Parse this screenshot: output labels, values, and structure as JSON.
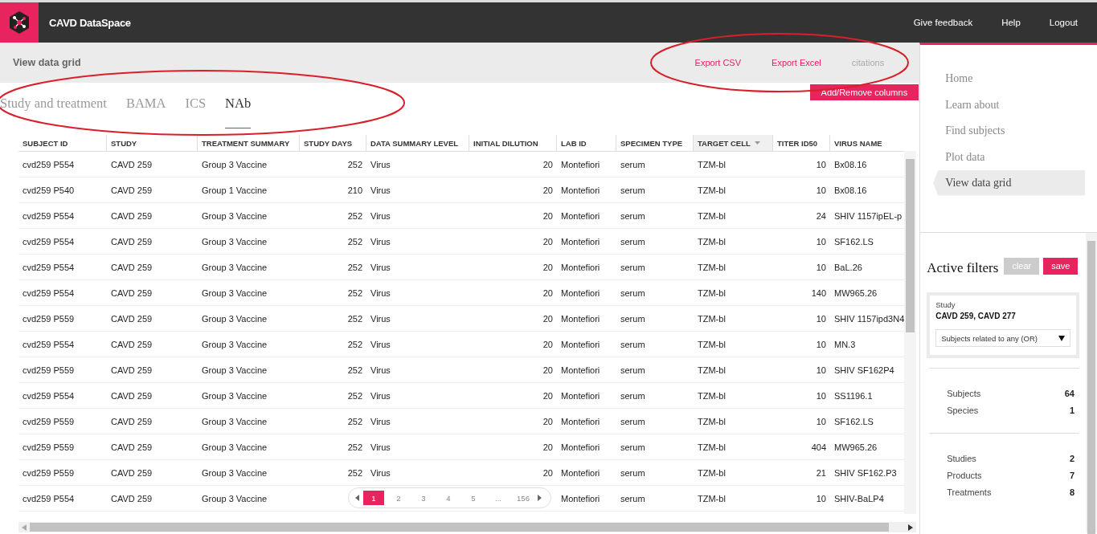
{
  "header": {
    "app_name": "CAVD DataSpace",
    "links": [
      "Give feedback",
      "Help",
      "Logout"
    ]
  },
  "title_bar": {
    "title": "View data grid",
    "actions": [
      {
        "label": "Export CSV",
        "kind": "link"
      },
      {
        "label": "Export Excel",
        "kind": "link"
      },
      {
        "label": "citations",
        "kind": "muted"
      }
    ]
  },
  "add_columns_button": "Add/Remove columns",
  "tabs": [
    {
      "label": "Study and treatment",
      "selected": false
    },
    {
      "label": "BAMA",
      "selected": false
    },
    {
      "label": "ICS",
      "selected": false
    },
    {
      "label": "NAb",
      "selected": true
    }
  ],
  "table": {
    "columns": [
      {
        "label": "SUBJECT ID",
        "sorted": false
      },
      {
        "label": "STUDY",
        "sorted": false
      },
      {
        "label": "TREATMENT SUMMARY",
        "sorted": false
      },
      {
        "label": "STUDY DAYS",
        "sorted": false
      },
      {
        "label": "DATA SUMMARY LEVEL",
        "sorted": false
      },
      {
        "label": "INITIAL DILUTION",
        "sorted": false
      },
      {
        "label": "LAB ID",
        "sorted": false
      },
      {
        "label": "SPECIMEN TYPE",
        "sorted": false
      },
      {
        "label": "TARGET CELL",
        "sorted": true
      },
      {
        "label": "TITER ID50",
        "sorted": false
      },
      {
        "label": "VIRUS NAME",
        "sorted": false
      }
    ],
    "rows": [
      {
        "subject_id": "cvd259 P554",
        "study": "CAVD 259",
        "treatment_summary": "Group 3 Vaccine",
        "study_days": "252",
        "data_summary_level": "Virus",
        "initial_dilution": "20",
        "lab_id": "Montefiori",
        "specimen_type": "serum",
        "target_cell": "TZM-bl",
        "titer_id50": "10",
        "virus_name": "Bx08.16"
      },
      {
        "subject_id": "cvd259 P540",
        "study": "CAVD 259",
        "treatment_summary": "Group 1 Vaccine",
        "study_days": "210",
        "data_summary_level": "Virus",
        "initial_dilution": "20",
        "lab_id": "Montefiori",
        "specimen_type": "serum",
        "target_cell": "TZM-bl",
        "titer_id50": "10",
        "virus_name": "Bx08.16"
      },
      {
        "subject_id": "cvd259 P554",
        "study": "CAVD 259",
        "treatment_summary": "Group 3 Vaccine",
        "study_days": "252",
        "data_summary_level": "Virus",
        "initial_dilution": "20",
        "lab_id": "Montefiori",
        "specimen_type": "serum",
        "target_cell": "TZM-bl",
        "titer_id50": "24",
        "virus_name": "SHIV 1157ipEL-p"
      },
      {
        "subject_id": "cvd259 P554",
        "study": "CAVD 259",
        "treatment_summary": "Group 3 Vaccine",
        "study_days": "252",
        "data_summary_level": "Virus",
        "initial_dilution": "20",
        "lab_id": "Montefiori",
        "specimen_type": "serum",
        "target_cell": "TZM-bl",
        "titer_id50": "10",
        "virus_name": "SF162.LS"
      },
      {
        "subject_id": "cvd259 P554",
        "study": "CAVD 259",
        "treatment_summary": "Group 3 Vaccine",
        "study_days": "252",
        "data_summary_level": "Virus",
        "initial_dilution": "20",
        "lab_id": "Montefiori",
        "specimen_type": "serum",
        "target_cell": "TZM-bl",
        "titer_id50": "10",
        "virus_name": "BaL.26"
      },
      {
        "subject_id": "cvd259 P554",
        "study": "CAVD 259",
        "treatment_summary": "Group 3 Vaccine",
        "study_days": "252",
        "data_summary_level": "Virus",
        "initial_dilution": "20",
        "lab_id": "Montefiori",
        "specimen_type": "serum",
        "target_cell": "TZM-bl",
        "titer_id50": "140",
        "virus_name": "MW965.26"
      },
      {
        "subject_id": "cvd259 P559",
        "study": "CAVD 259",
        "treatment_summary": "Group 3 Vaccine",
        "study_days": "252",
        "data_summary_level": "Virus",
        "initial_dilution": "20",
        "lab_id": "Montefiori",
        "specimen_type": "serum",
        "target_cell": "TZM-bl",
        "titer_id50": "10",
        "virus_name": "SHIV 1157ipd3N4"
      },
      {
        "subject_id": "cvd259 P554",
        "study": "CAVD 259",
        "treatment_summary": "Group 3 Vaccine",
        "study_days": "252",
        "data_summary_level": "Virus",
        "initial_dilution": "20",
        "lab_id": "Montefiori",
        "specimen_type": "serum",
        "target_cell": "TZM-bl",
        "titer_id50": "10",
        "virus_name": "MN.3"
      },
      {
        "subject_id": "cvd259 P559",
        "study": "CAVD 259",
        "treatment_summary": "Group 3 Vaccine",
        "study_days": "252",
        "data_summary_level": "Virus",
        "initial_dilution": "20",
        "lab_id": "Montefiori",
        "specimen_type": "serum",
        "target_cell": "TZM-bl",
        "titer_id50": "10",
        "virus_name": "SHIV SF162P4"
      },
      {
        "subject_id": "cvd259 P554",
        "study": "CAVD 259",
        "treatment_summary": "Group 3 Vaccine",
        "study_days": "252",
        "data_summary_level": "Virus",
        "initial_dilution": "20",
        "lab_id": "Montefiori",
        "specimen_type": "serum",
        "target_cell": "TZM-bl",
        "titer_id50": "10",
        "virus_name": "SS1196.1"
      },
      {
        "subject_id": "cvd259 P559",
        "study": "CAVD 259",
        "treatment_summary": "Group 3 Vaccine",
        "study_days": "252",
        "data_summary_level": "Virus",
        "initial_dilution": "20",
        "lab_id": "Montefiori",
        "specimen_type": "serum",
        "target_cell": "TZM-bl",
        "titer_id50": "10",
        "virus_name": "SF162.LS"
      },
      {
        "subject_id": "cvd259 P559",
        "study": "CAVD 259",
        "treatment_summary": "Group 3 Vaccine",
        "study_days": "252",
        "data_summary_level": "Virus",
        "initial_dilution": "20",
        "lab_id": "Montefiori",
        "specimen_type": "serum",
        "target_cell": "TZM-bl",
        "titer_id50": "404",
        "virus_name": "MW965.26"
      },
      {
        "subject_id": "cvd259 P559",
        "study": "CAVD 259",
        "treatment_summary": "Group 3 Vaccine",
        "study_days": "252",
        "data_summary_level": "Virus",
        "initial_dilution": "20",
        "lab_id": "Montefiori",
        "specimen_type": "serum",
        "target_cell": "TZM-bl",
        "titer_id50": "21",
        "virus_name": "SHIV SF162.P3"
      },
      {
        "subject_id": "cvd259 P554",
        "study": "CAVD 259",
        "treatment_summary": "Group 3 Vaccine",
        "lab_id": "Montefiori",
        "specimen_type": "serum",
        "target_cell": "TZM-bl",
        "titer_id50": "10",
        "virus_name": "SHIV-BaLP4"
      }
    ]
  },
  "pagination": [
    {
      "label": "1",
      "selected": true
    },
    {
      "label": "2",
      "selected": false
    },
    {
      "label": "3",
      "selected": false
    },
    {
      "label": "4",
      "selected": false
    },
    {
      "label": "5",
      "selected": false
    },
    {
      "label": "...",
      "selected": false
    },
    {
      "label": "156",
      "selected": false
    }
  ],
  "sidebar": {
    "nav": [
      {
        "label": "Home",
        "selected": false
      },
      {
        "label": "Learn about",
        "selected": false
      },
      {
        "label": "Find subjects",
        "selected": false
      },
      {
        "label": "Plot data",
        "selected": false
      },
      {
        "label": "View data grid",
        "selected": true
      }
    ],
    "filters_title": "Active filters",
    "clear_button": "clear",
    "save_button": "save",
    "filter": {
      "label": "Study",
      "value": "CAVD 259, CAVD 277",
      "operator": "Subjects related to any (OR)"
    },
    "count_groups": [
      [
        {
          "label": "Subjects",
          "count": "64"
        },
        {
          "label": "Species",
          "count": "1"
        }
      ],
      [
        {
          "label": "Studies",
          "count": "2"
        },
        {
          "label": "Products",
          "count": "7"
        },
        {
          "label": "Treatments",
          "count": "8"
        }
      ]
    ]
  },
  "annotations": [
    {
      "kind": "ellipse"
    },
    {
      "kind": "ellipse"
    }
  ]
}
